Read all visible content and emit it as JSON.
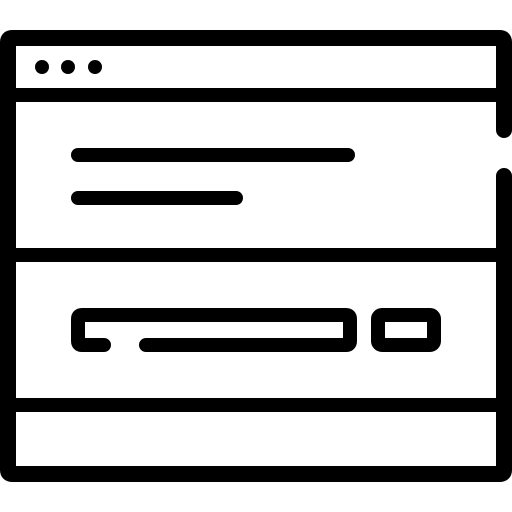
{
  "icon": {
    "name": "browser-window-form-icon",
    "stroke_color": "#000000",
    "background_color": "#ffffff",
    "style": "line-art",
    "title_bar_dots": 3
  }
}
